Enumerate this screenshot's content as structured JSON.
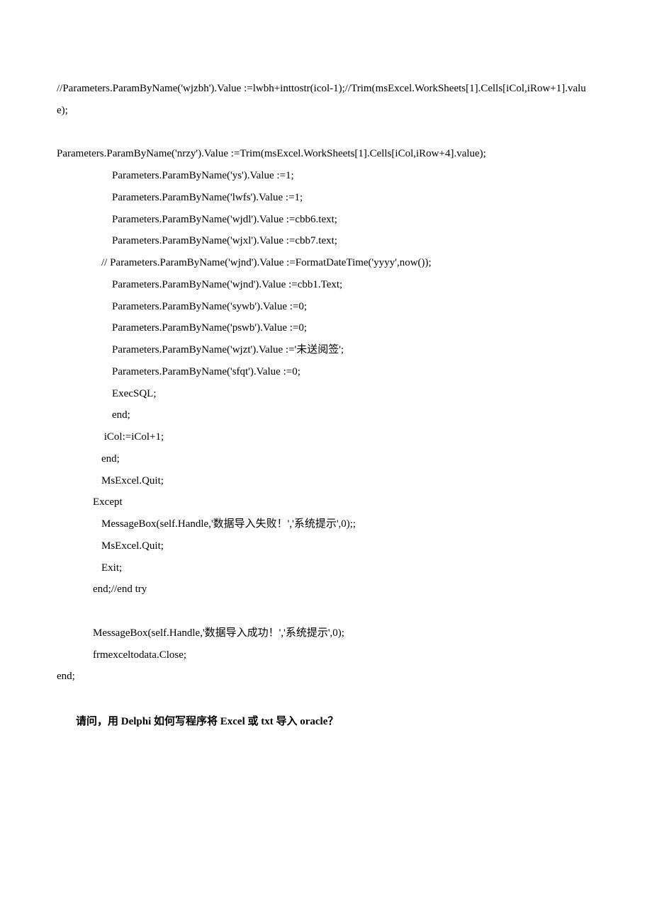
{
  "lines": {
    "l1": "//Parameters.ParamByName('wjzbh').Value :=lwbh+inttostr(icol-1);//Trim(msExcel.WorkSheets[1].Cells[iCol,iRow+1].value);",
    "l2": "Parameters.ParamByName('nrzy').Value :=Trim(msExcel.WorkSheets[1].Cells[iCol,iRow+4].value);",
    "l3": "Parameters.ParamByName('ys').Value :=1;",
    "l4": "Parameters.ParamByName('lwfs').Value :=1;",
    "l5": "Parameters.ParamByName('wjdl').Value :=cbb6.text;",
    "l6": "Parameters.ParamByName('wjxl').Value :=cbb7.text;",
    "l7": "// Parameters.ParamByName('wjnd').Value :=FormatDateTime('yyyy',now());",
    "l8": "Parameters.ParamByName('wjnd').Value :=cbb1.Text;",
    "l9": "Parameters.ParamByName('sywb').Value :=0;",
    "l10": "Parameters.ParamByName('pswb').Value :=0;",
    "l11": "Parameters.ParamByName('wjzt').Value :='未送阅签';",
    "l12": "Parameters.ParamByName('sfqt').Value :=0;",
    "l13": "ExecSQL;",
    "l14": "end;",
    "l15": " iCol:=iCol+1;",
    "l16": "end;",
    "l17": "MsExcel.Quit;",
    "l18": "Except",
    "l19": "MessageBox(self.Handle,'数据导入失败！','系统提示',0);;",
    "l20": "MsExcel.Quit;",
    "l21": "Exit;",
    "l22": "end;//end try",
    "l23": "MessageBox(self.Handle,'数据导入成功！','系统提示',0);",
    "l24": "frmexceltodata.Close;",
    "l25": "end;"
  },
  "question": "请问，用 Delphi 如何写程序将 Excel 或 txt 导入 oracle？"
}
